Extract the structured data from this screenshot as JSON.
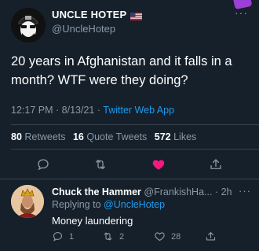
{
  "tweet": {
    "author_name": "UNCLE HOTEP",
    "author_handle": "@UncleHotep",
    "text": "20 years in Afghanistan and it falls in a month? WTF were they doing?",
    "time": "12:17 PM",
    "date": "8/13/21",
    "app": "Twitter Web App",
    "retweets_count": "80",
    "retweets_label": "Retweets",
    "quotes_count": "16",
    "quotes_label": "Quote Tweets",
    "likes_count": "572",
    "likes_label": "Likes",
    "more_label": "···",
    "liked": true,
    "colors": {
      "like": "#f91880",
      "accent": "#1d9bf0",
      "muted": "#8b98a5"
    }
  },
  "reply": {
    "author_name": "Chuck the Hammer",
    "author_handle": "@FrankishHa...",
    "age": "2h",
    "more_label": "···",
    "replying_prefix": "Replying to",
    "replying_to": "@UncleHotep",
    "text": "Money laundering",
    "reply_count": "1",
    "retweet_count": "2",
    "like_count": "28"
  },
  "icons": {
    "verified_flag": "us-flag-icon",
    "reply": "reply-icon",
    "retweet": "retweet-icon",
    "like": "heart-icon",
    "share": "share-icon"
  }
}
